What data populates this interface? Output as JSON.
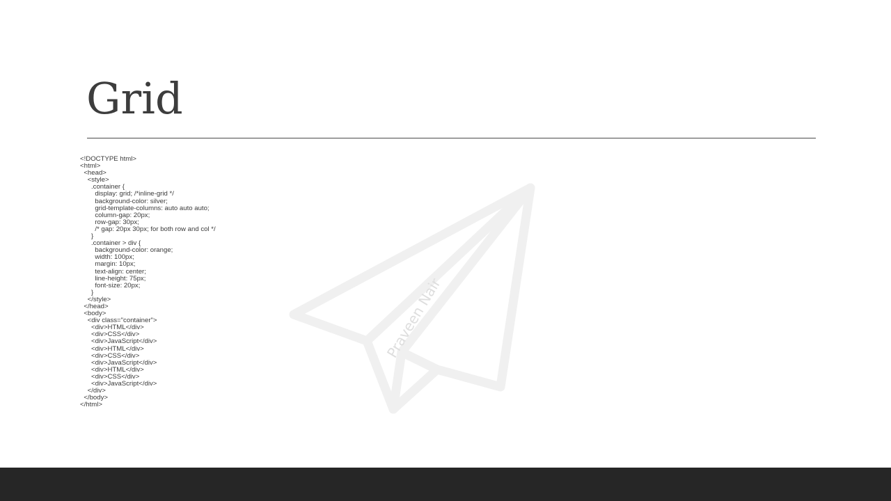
{
  "slide": {
    "title": "Grid",
    "watermark_text": "Praveen Nair",
    "code_lines": [
      "<!DOCTYPE html>",
      "<html>",
      "  <head>",
      "    <style>",
      "      .container {",
      "        display: grid; /*inline-grid */",
      "        background-color: silver;",
      "        grid-template-columns: auto auto auto;",
      "        column-gap: 20px;",
      "        row-gap: 30px;",
      "        /* gap: 20px 30px; for both row and col */",
      "      }",
      "      .container > div {",
      "        background-color: orange;",
      "        width: 100px;",
      "        margin: 10px;",
      "        text-align: center;",
      "        line-height: 75px;",
      "        font-size: 20px;",
      "      }",
      "    </style>",
      "  </head>",
      "  <body>",
      "    <div class=\"container\">",
      "      <div>HTML</div>",
      "      <div>CSS</div>",
      "      <div>JavaScript</div>",
      "      <div>HTML</div>",
      "      <div>CSS</div>",
      "      <div>JavaScript</div>",
      "      <div>HTML</div>",
      "      <div>CSS</div>",
      "      <div>JavaScript</div>",
      "    </div>",
      "  </body>",
      "</html>"
    ]
  },
  "icons": {
    "watermark": "paper-plane-icon"
  },
  "colors": {
    "title": "#3d3d3d",
    "rule": "#4a4a4a",
    "watermark": "#f0f0f0",
    "footer": "#262626",
    "background": "#ffffff"
  }
}
